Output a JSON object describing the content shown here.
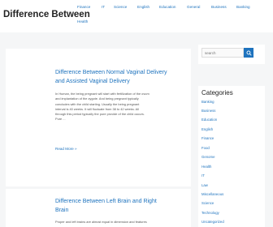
{
  "site": {
    "title": "Difference Between"
  },
  "nav": {
    "items": [
      {
        "label": "Finance"
      },
      {
        "label": "IT"
      },
      {
        "label": "Science"
      },
      {
        "label": "English"
      },
      {
        "label": "Education"
      },
      {
        "label": "General"
      },
      {
        "label": "Business"
      },
      {
        "label": "Banking"
      },
      {
        "label": "Health"
      }
    ]
  },
  "posts": [
    {
      "title_line1": "Difference Between Normal Vaginal Delivery",
      "title_line2": "and Assisted Vaginal Delivery",
      "excerpt": [
        "In Human, the being pregnant will start with fertilization of the ovum",
        "and implantation of the zygote. And being pregnant typically",
        "concludes with the child starting. Usually the being pregnant",
        "interval is 40 weeks. It will fluctuate from 38 to 42 weeks. All",
        "through this period typically the pure provide of the child occurs.",
        "Pure ..."
      ],
      "read_more": "Read More »"
    },
    {
      "title_line1": "Difference Between Left Brain and Right",
      "title_line2": "Brain",
      "excerpt": [
        "Proper and left brains are almost equal in dimension and features"
      ]
    }
  ],
  "search": {
    "placeholder": "search"
  },
  "categories": {
    "title": "Categories",
    "items": [
      "Banking",
      "Business",
      "Education",
      "English",
      "Finance",
      "Food",
      "Genome",
      "Health",
      "IT",
      "Law",
      "Miscellaneous",
      "Science",
      "Technology",
      "Uncategorized"
    ]
  },
  "colors": {
    "accent": "#1e73be",
    "background": "#f5f6f7",
    "card": "#ffffff"
  }
}
